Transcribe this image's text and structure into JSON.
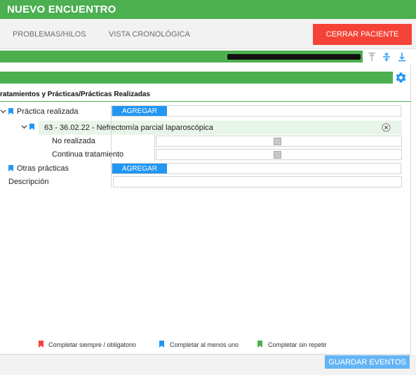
{
  "header": {
    "title": "NUEVO ENCUENTRO"
  },
  "tabs": [
    {
      "label": "PROBLEMAS/HILOS"
    },
    {
      "label": "VISTA CRONOLÓGICA"
    }
  ],
  "actions": {
    "close_patient": "CERRAR PACIENTE",
    "save_events": "GUARDAR EVENTOS"
  },
  "toolbar": {
    "icons": [
      "collapse-top-icon",
      "expand-collapse-icon",
      "download-icon"
    ]
  },
  "section": {
    "breadcrumb": "ratamientos y Prácticas/Prácticas Realizadas"
  },
  "form": {
    "practica_realizada": {
      "label": "Práctica realizada",
      "button": "AGREGAR"
    },
    "procedure": {
      "text": "63 - 36.02.22 - Nefrectomía parcial laparoscópica"
    },
    "no_realizada": {
      "label": "No realizada"
    },
    "continua_tratamiento": {
      "label": "Continua tratamiento"
    },
    "otras_practicas": {
      "label": "Otras prácticas",
      "button": "AGREGAR"
    },
    "descripcion": {
      "label": "Descripción"
    }
  },
  "legend": [
    {
      "label": "Completar siempre / obligatorio",
      "color": "#f44336"
    },
    {
      "label": "Completar al menos uno",
      "color": "#2196f3"
    },
    {
      "label": "Completar sin repetir",
      "color": "#4caf50"
    }
  ],
  "colors": {
    "brand_green": "#4caf50",
    "danger": "#f44336",
    "accent_blue": "#2196f3"
  }
}
